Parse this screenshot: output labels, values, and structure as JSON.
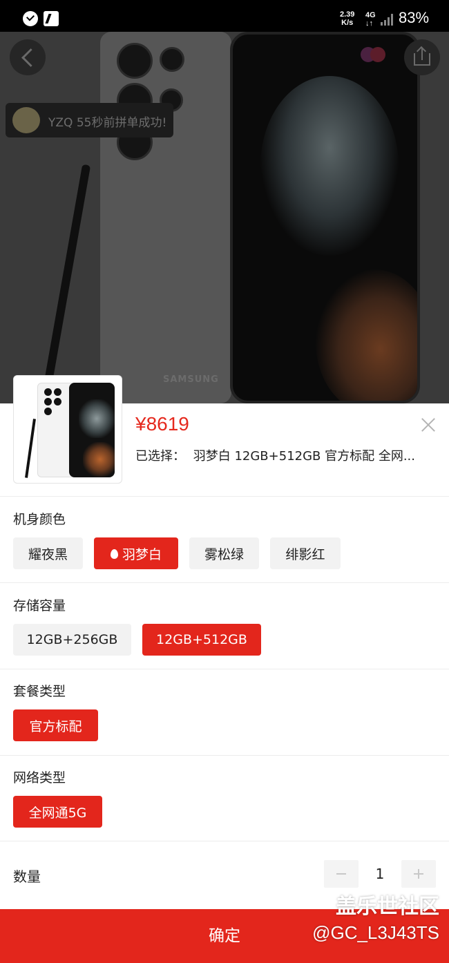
{
  "status_bar": {
    "net_speed": "2.39",
    "net_speed_unit": "K/s",
    "network_type": "4G",
    "battery": "83%"
  },
  "hero": {
    "brand_text": "SAMSUNG",
    "toast": "YZQ 55秒前拼单成功!"
  },
  "product": {
    "price": "¥8619",
    "selected_prefix": "已选择：",
    "selected_value": "羽梦白 12GB+512GB 官方标配 全网..."
  },
  "sections": {
    "color": {
      "title": "机身颜色",
      "options": [
        "耀夜黑",
        "羽梦白",
        "雾松绿",
        "绯影红"
      ],
      "selected": "羽梦白"
    },
    "storage": {
      "title": "存储容量",
      "options": [
        "12GB+256GB",
        "12GB+512GB"
      ],
      "selected": "12GB+512GB"
    },
    "bundle": {
      "title": "套餐类型",
      "options": [
        "官方标配"
      ],
      "selected": "官方标配"
    },
    "network": {
      "title": "网络类型",
      "options": [
        "全网通5G"
      ],
      "selected": "全网通5G"
    }
  },
  "quantity": {
    "label": "数量",
    "value": "1"
  },
  "confirm_label": "确定",
  "watermark": {
    "line1": "盖乐世社区",
    "line2": "@GC_L3J43TS"
  },
  "colors": {
    "accent": "#e3261c",
    "price": "#e5291e",
    "chip_bg": "#f2f2f2"
  },
  "icons": [
    "check-badge-icon",
    "nfc-icon",
    "signal-icon",
    "back-arrow-icon",
    "share-icon",
    "favorite-icon",
    "close-icon",
    "flame-icon",
    "minus-icon",
    "plus-icon"
  ]
}
